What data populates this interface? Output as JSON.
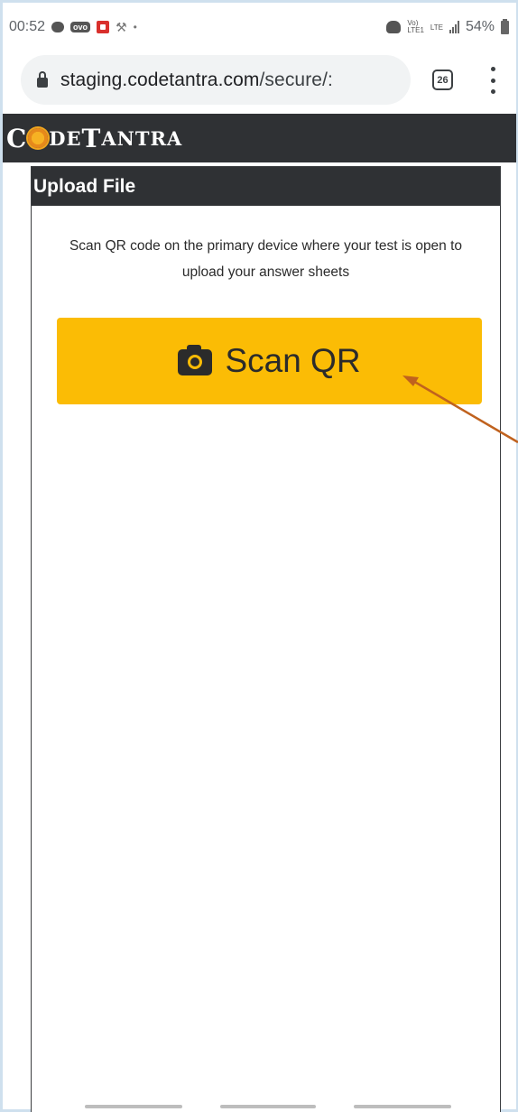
{
  "status_bar": {
    "time": "00:52",
    "ovo_label": "ovo",
    "volte_top": "Vo)",
    "volte_bottom": "LTE1",
    "network": "LTE",
    "battery": "54%"
  },
  "browser": {
    "url_domain": "staging.codetantra.com",
    "url_path": "/secure/:",
    "tab_count": "26"
  },
  "site": {
    "logo_prefix": "C",
    "logo_rest_a": "DE",
    "logo_T": "T",
    "logo_rest_b": "ANTRA"
  },
  "card": {
    "title": "Upload File",
    "instructions": "Scan QR code on the primary device where your test is open to upload your answer sheets",
    "scan_button_label": "Scan QR"
  },
  "colors": {
    "header_bg": "#2f3134",
    "button_bg": "#fbbc05",
    "arrow": "#c0621e"
  },
  "icons": {
    "lock": "lock-icon",
    "tabs": "tab-switcher-icon",
    "menu": "overflow-menu-icon",
    "camera": "camera-icon"
  }
}
